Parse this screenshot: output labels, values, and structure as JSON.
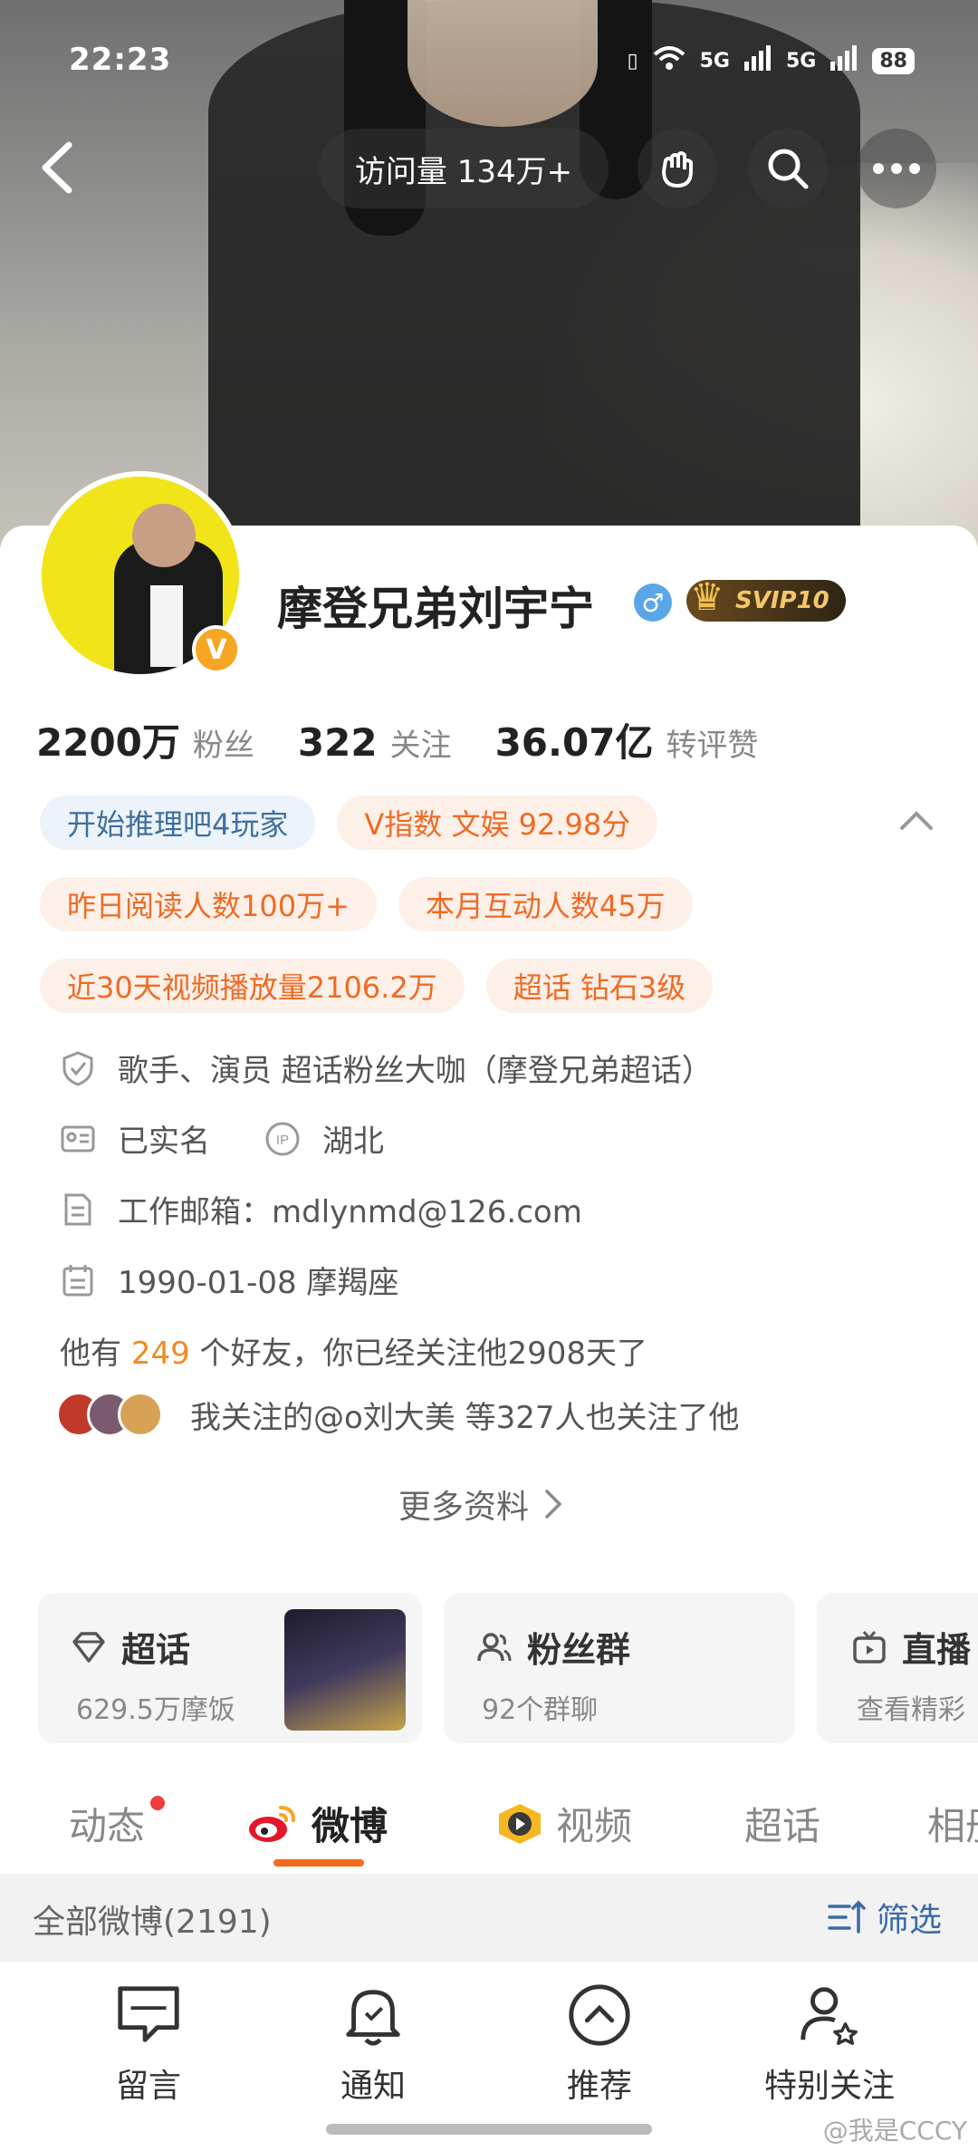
{
  "status_bar": {
    "time": "22:23",
    "network1": "5G",
    "network2": "5G",
    "battery": "88"
  },
  "header": {
    "visits": "访问量 134万+"
  },
  "profile": {
    "name": "摩登兄弟刘宇宁",
    "gender_symbol": "♂",
    "svip": "SVIP10",
    "verified_badge": "V",
    "stats": [
      {
        "num": "2200万",
        "label": "粉丝"
      },
      {
        "num": "322",
        "label": "关注"
      },
      {
        "num": "36.07亿",
        "label": "转评赞"
      }
    ],
    "tags_row1": [
      "开始推理吧4玩家",
      "V指数 文娱 92.98分"
    ],
    "tags_row2": [
      "昨日阅读人数100万+",
      "本月互动人数45万"
    ],
    "tags_row3": [
      "近30天视频播放量2106.2万",
      "超话 钻石3级"
    ],
    "verify_text": "歌手、演员 超话粉丝大咖（摩登兄弟超话）",
    "realname": "已实名",
    "ip_label": "IP",
    "ip_location": "湖北",
    "email": "工作邮箱：mdlynmd@126.com",
    "birthday": "1990-01-08 摩羯座",
    "friends_prefix": "他有 ",
    "friends_count": "249",
    "friends_suffix": " 个好友，你已经关注他2908天了",
    "mutual_text": "我关注的@o刘大美 等327人也关注了他",
    "more_info": "更多资料"
  },
  "features": [
    {
      "title": "超话",
      "sub": "629.5万摩饭"
    },
    {
      "title": "粉丝群",
      "sub": "92个群聊"
    },
    {
      "title": "直播",
      "sub": "查看精彩"
    }
  ],
  "tabs": [
    "动态",
    "微博",
    "视频",
    "超话",
    "相册"
  ],
  "filter": {
    "count": "全部微博(2191)",
    "label": "筛选"
  },
  "bottom_nav": [
    "留言",
    "通知",
    "推荐",
    "特别关注"
  ],
  "watermark": "@我是CCCY",
  "colors": {
    "accent": "#f26b1d",
    "link": "#3b6aa6",
    "tag_orange": "#f06a24",
    "tag_blue": "#3f6f9e"
  }
}
